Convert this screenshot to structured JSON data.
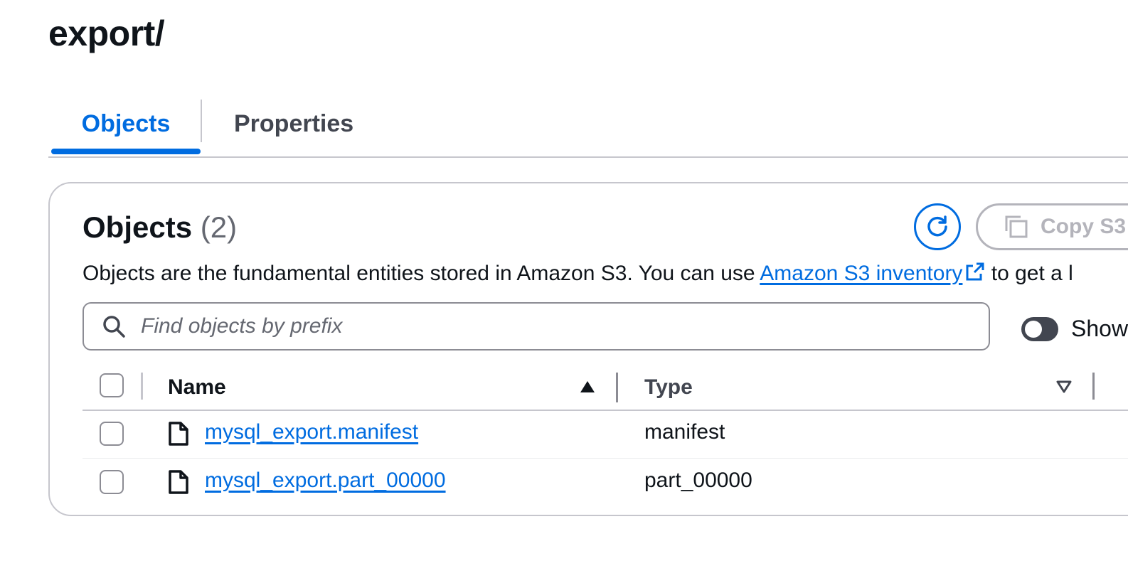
{
  "page": {
    "title": "export/"
  },
  "tabs": [
    {
      "label": "Objects",
      "active": true
    },
    {
      "label": "Properties",
      "active": false
    }
  ],
  "objects_panel": {
    "heading": "Objects",
    "count": "(2)",
    "copy_button_label": "Copy S3",
    "description_before": "Objects are the fundamental entities stored in Amazon S3. You can use ",
    "description_link": "Amazon S3 inventory",
    "description_after": " to get a l",
    "search": {
      "placeholder": "Find objects by prefix",
      "value": ""
    },
    "toggle_label": "Show",
    "toggle_on": false
  },
  "table": {
    "columns": [
      "Name",
      "Type"
    ],
    "sort": {
      "Name": "ascending",
      "Type": "unsorted"
    },
    "rows": [
      {
        "name": "mysql_export.manifest",
        "type": "manifest"
      },
      {
        "name": "mysql_export.part_00000",
        "type": "part_00000"
      }
    ]
  },
  "colors": {
    "accent": "#006ce0",
    "text": "#0f141a",
    "muted": "#656871",
    "border": "#c6c6cd",
    "disabled": "#b4b4bb"
  },
  "icons": {
    "refresh": "refresh-icon",
    "copy": "copy-icon",
    "external_link": "external-link-icon",
    "search": "search-icon",
    "file": "file-icon",
    "sort_asc": "sort-ascending-icon",
    "sort_none": "sort-descending-outline-icon"
  }
}
